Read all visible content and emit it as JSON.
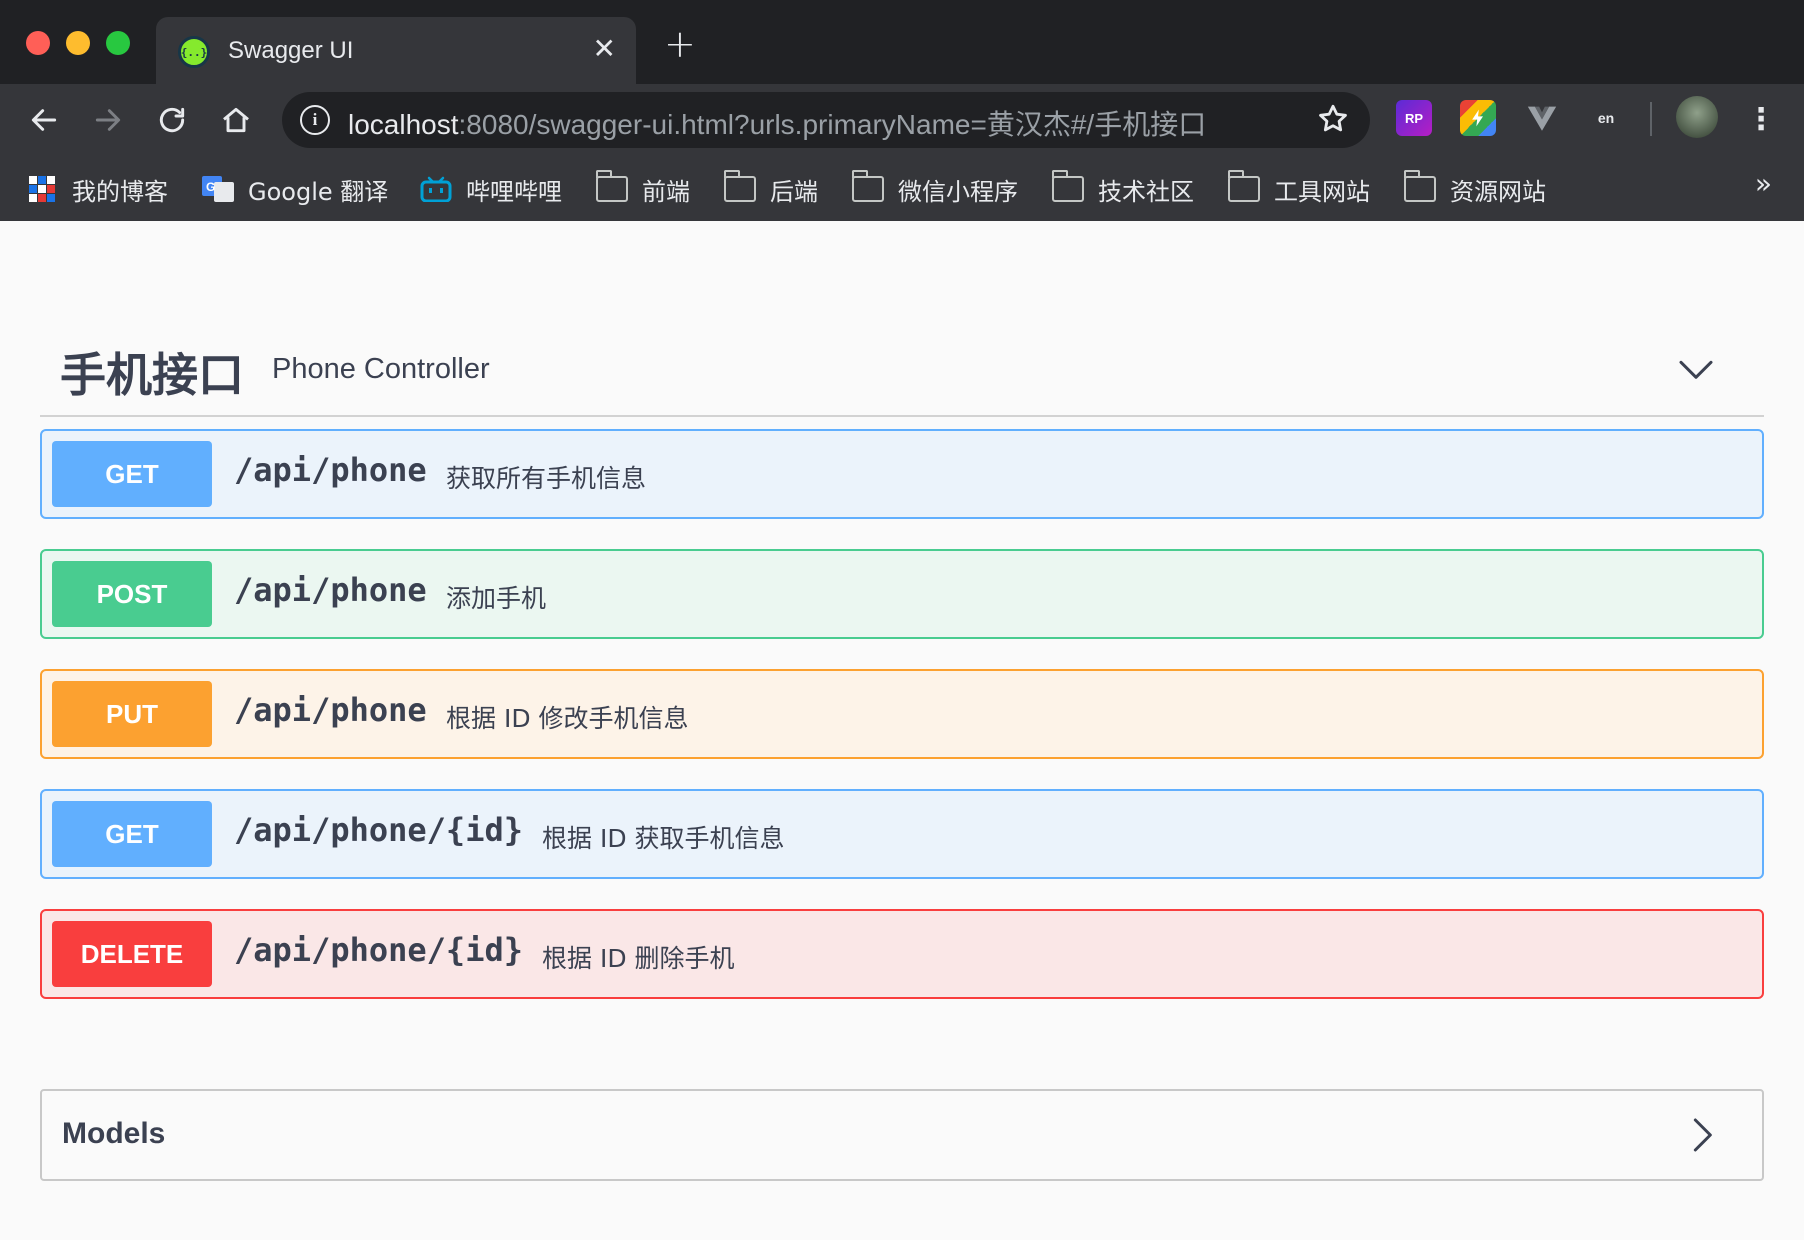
{
  "browser": {
    "tab_title": "Swagger UI",
    "favicon_text": "{..}",
    "url_host": "localhost",
    "url_rest": ":8080/swagger-ui.html?urls.primaryName=黄汉杰#/手机接口",
    "extensions": {
      "rp_label": "RP",
      "translate_label": "en"
    },
    "bookmarks": [
      {
        "label": "我的博客"
      },
      {
        "label": "Google 翻译"
      },
      {
        "label": "哔哩哔哩"
      },
      {
        "label": "前端"
      },
      {
        "label": "后端"
      },
      {
        "label": "微信小程序"
      },
      {
        "label": "技术社区"
      },
      {
        "label": "工具网站"
      },
      {
        "label": "资源网站"
      }
    ],
    "bookmarks_overflow": "»"
  },
  "swagger": {
    "tag": {
      "name": "手机接口",
      "description": "Phone Controller"
    },
    "operations": [
      {
        "method": "GET",
        "path": "/api/phone",
        "summary": "获取所有手机信息"
      },
      {
        "method": "POST",
        "path": "/api/phone",
        "summary": "添加手机"
      },
      {
        "method": "PUT",
        "path": "/api/phone",
        "summary": "根据 ID 修改手机信息"
      },
      {
        "method": "GET",
        "path": "/api/phone/{id}",
        "summary": "根据 ID 获取手机信息"
      },
      {
        "method": "DELETE",
        "path": "/api/phone/{id}",
        "summary": "根据 ID 删除手机"
      }
    ],
    "models_title": "Models"
  },
  "colors": {
    "get": "#61affe",
    "post": "#49cc90",
    "put": "#fca130",
    "delete": "#f93e3e"
  }
}
